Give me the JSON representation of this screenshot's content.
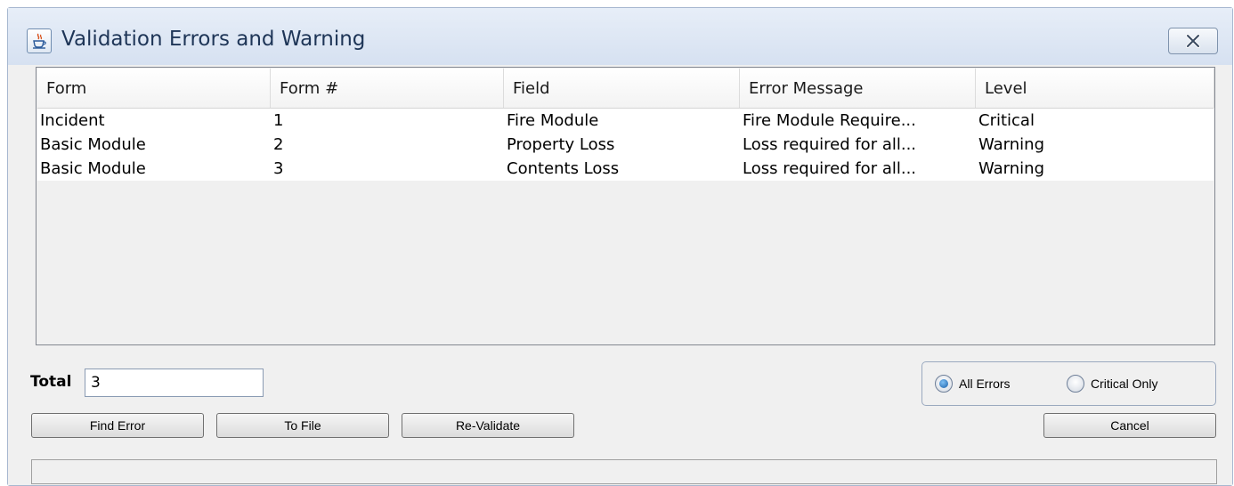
{
  "window": {
    "title": "Validation Errors and Warning",
    "icon": "java-cup-icon",
    "close_icon": "close-icon"
  },
  "table": {
    "columns": [
      "Form",
      "Form #",
      "Field",
      "Error Message",
      "Level"
    ],
    "rows": [
      [
        "Incident",
        "1",
        "Fire Module",
        "Fire Module Require...",
        "Critical"
      ],
      [
        "Basic Module",
        "2",
        "Property Loss",
        "Loss required for all...",
        "Warning"
      ],
      [
        "Basic Module",
        "3",
        "Contents Loss",
        "Loss required for all...",
        "Warning"
      ]
    ]
  },
  "total": {
    "label": "Total",
    "value": "3"
  },
  "filter": {
    "options": [
      {
        "label": "All Errors",
        "selected": true
      },
      {
        "label": "Critical Only",
        "selected": false
      }
    ]
  },
  "buttons": {
    "find_error": "Find Error",
    "to_file": "To File",
    "revalidate": "Re-Validate",
    "cancel": "Cancel"
  },
  "status": {
    "text": ""
  }
}
